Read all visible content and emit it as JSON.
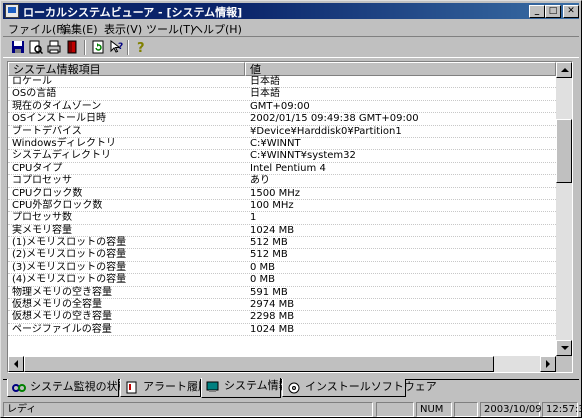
{
  "window": {
    "title": "ローカルシステムビューア - [システム情報]",
    "min_glyph": "_",
    "max_glyph": "□",
    "close_glyph": "✕"
  },
  "menu": [
    {
      "label": "ファイル(F)"
    },
    {
      "label": "編集(E)"
    },
    {
      "label": "表示(V)"
    },
    {
      "label": "ツール(T)"
    },
    {
      "label": "ヘルプ(H)"
    }
  ],
  "toolbar": {
    "icons": [
      "save-icon",
      "print-preview-icon",
      "print-icon",
      "exit-icon",
      "refresh-icon",
      "help-pointer-icon",
      "question-icon"
    ]
  },
  "table": {
    "headers": [
      "システム情報項目",
      "値"
    ],
    "rows": [
      [
        "ロケール",
        "日本語"
      ],
      [
        "OSの言語",
        "日本語"
      ],
      [
        "現在のタイムゾーン",
        "GMT+09:00"
      ],
      [
        "OSインストール日時",
        "2002/01/15 09:49:38 GMT+09:00"
      ],
      [
        "ブートデバイス",
        "¥Device¥Harddisk0¥Partition1"
      ],
      [
        "Windowsディレクトリ",
        "C:¥WINNT"
      ],
      [
        "システムディレクトリ",
        "C:¥WINNT¥system32"
      ],
      [
        "CPUタイプ",
        "Intel Pentium 4"
      ],
      [
        "コプロセッサ",
        "あり"
      ],
      [
        "CPUクロック数",
        "1500 MHz"
      ],
      [
        "CPU外部クロック数",
        "100 MHz"
      ],
      [
        "プロセッサ数",
        "1"
      ],
      [
        "実メモリ容量",
        "1024 MB"
      ],
      [
        "(1)メモリスロットの容量",
        "512 MB"
      ],
      [
        "(2)メモリスロットの容量",
        "512 MB"
      ],
      [
        "(3)メモリスロットの容量",
        "0 MB"
      ],
      [
        "(4)メモリスロットの容量",
        "0 MB"
      ],
      [
        "物理メモリの空き容量",
        "591 MB"
      ],
      [
        "仮想メモリの全容量",
        "2974 MB"
      ],
      [
        "仮想メモリの空き容量",
        "2298 MB"
      ],
      [
        "ページファイルの容量",
        "1024 MB"
      ]
    ]
  },
  "tabs": [
    {
      "label": "システム監視の状態",
      "icon": "monitor-icon"
    },
    {
      "label": "アラート履歴",
      "icon": "alert-icon"
    },
    {
      "label": "システム情報",
      "icon": "system-info-icon",
      "active": true
    },
    {
      "label": "インストールソフトウェア",
      "icon": "install-software-icon"
    }
  ],
  "status": {
    "text": "レディ",
    "num": "NUM",
    "date": "2003/10/09",
    "time": "12:57:31"
  }
}
